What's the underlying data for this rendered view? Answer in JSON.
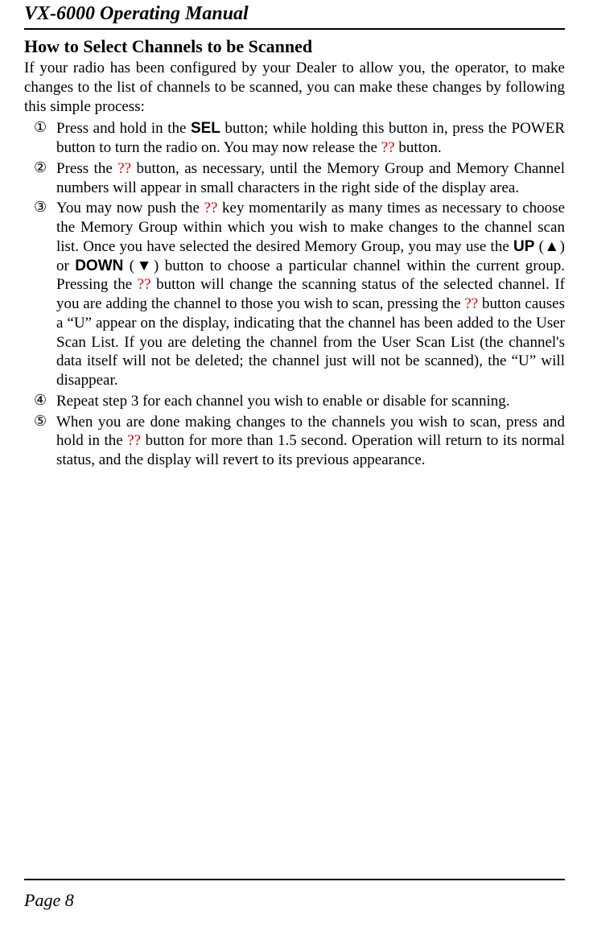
{
  "doc_title": "VX-6000 Operating Manual",
  "section_title": "How to Select Channels to be Scanned",
  "intro": "If your radio has been configured by your Dealer to allow you, the operator, to make changes to the list of channels to be scanned, you can make these changes by following this simple process:",
  "items": [
    {
      "marker": "①",
      "parts": [
        {
          "t": "Press and hold in the "
        },
        {
          "t": "SEL",
          "cls": "bold-sans"
        },
        {
          "t": " button; while holding this button in, press the POWER button to turn the radio on. You may now release the "
        },
        {
          "t": "??",
          "cls": "red"
        },
        {
          "t": " button."
        }
      ]
    },
    {
      "marker": "②",
      "parts": [
        {
          "t": "Press the "
        },
        {
          "t": "??",
          "cls": "red"
        },
        {
          "t": " button, as necessary, until the Memory Group and Memory Channel numbers will appear in small characters in the right side of the display area."
        }
      ]
    },
    {
      "marker": "③",
      "parts": [
        {
          "t": "You may now push the "
        },
        {
          "t": "??",
          "cls": "red"
        },
        {
          "t": " key momentarily as many times as necessary to choose the Memory Group within which you wish to make changes to the channel scan list. Once you have selected the desired Memory Group, you may use the "
        },
        {
          "t": "UP",
          "cls": "bold-sans"
        },
        {
          "t": " (▲) or "
        },
        {
          "t": "DOWN",
          "cls": "bold-sans"
        },
        {
          "t": " (▼) button to choose a particular channel within the current group. Pressing the "
        },
        {
          "t": "??",
          "cls": "red"
        },
        {
          "t": " button will change the scanning status of the selected channel. If you are adding the channel to those you wish to scan, pressing the "
        },
        {
          "t": "??",
          "cls": "red"
        },
        {
          "t": " button causes a “U” appear on the display, indicating that the channel has been added to the User Scan List. If you are deleting the channel from the User Scan List (the channel's data itself will not be deleted; the channel just will not be scanned), the “U” will disappear."
        }
      ]
    },
    {
      "marker": "④",
      "parts": [
        {
          "t": "Repeat step 3 for each channel you wish to enable or disable for scanning."
        }
      ]
    },
    {
      "marker": "⑤",
      "parts": [
        {
          "t": "When you are done making changes to the channels you wish to scan, press and hold in the "
        },
        {
          "t": "??",
          "cls": "red"
        },
        {
          "t": " button for more than 1.5 second. Operation will return to its normal status, and the display will revert to its previous appearance."
        }
      ]
    }
  ],
  "page_label": "Page 8"
}
